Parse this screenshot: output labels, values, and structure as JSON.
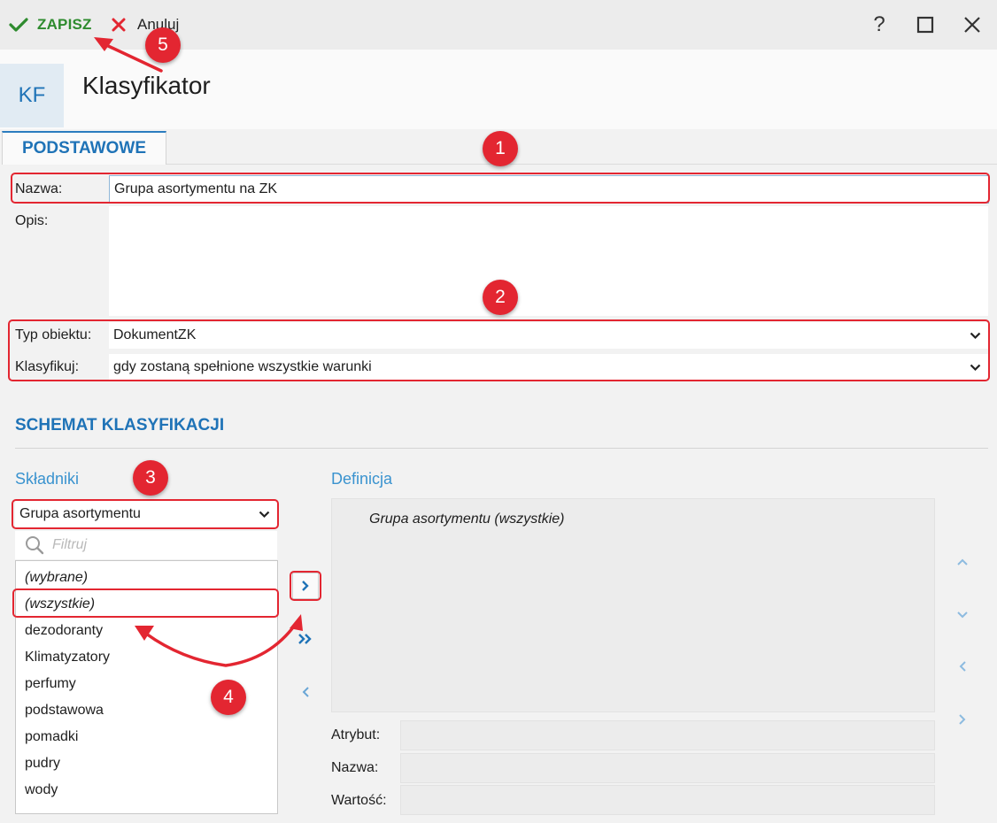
{
  "toolbar": {
    "save_label": "ZAPISZ",
    "cancel_label": "Anuluj"
  },
  "window": {
    "help": "?"
  },
  "header": {
    "badge": "KF",
    "title": "Klasyfikator"
  },
  "tabs": [
    {
      "label": "PODSTAWOWE"
    }
  ],
  "form": {
    "name_label": "Nazwa:",
    "name_value": "Grupa asortymentu na ZK",
    "desc_label": "Opis:",
    "desc_value": "",
    "object_type_label": "Typ obiektu:",
    "object_type_value": "DokumentZK",
    "classify_label": "Klasyfikuj:",
    "classify_value": "gdy zostaną spełnione wszystkie warunki"
  },
  "schema": {
    "title": "SCHEMAT KLASYFIKACJI",
    "components_label": "Składniki",
    "definition_label": "Definicja",
    "component_select": "Grupa asortymentu",
    "filter_placeholder": "Filtruj",
    "items": [
      "(wybrane)",
      "(wszystkie)",
      "dezodoranty",
      "Klimatyzatory",
      "perfumy",
      "podstawowa",
      "pomadki",
      "pudry",
      "wody"
    ],
    "definition_text": "Grupa asortymentu (wszystkie)",
    "attr_label": "Atrybut:",
    "attr_value": "",
    "name_label": "Nazwa:",
    "name_value": "",
    "value_label": "Wartość:",
    "value_value": ""
  },
  "annotations": [
    "1",
    "2",
    "3",
    "4",
    "5"
  ],
  "colors": {
    "accent": "#1f73b7",
    "save_green": "#2e8b2e",
    "cancel_red": "#e32631",
    "annotation_red": "#e32631"
  }
}
